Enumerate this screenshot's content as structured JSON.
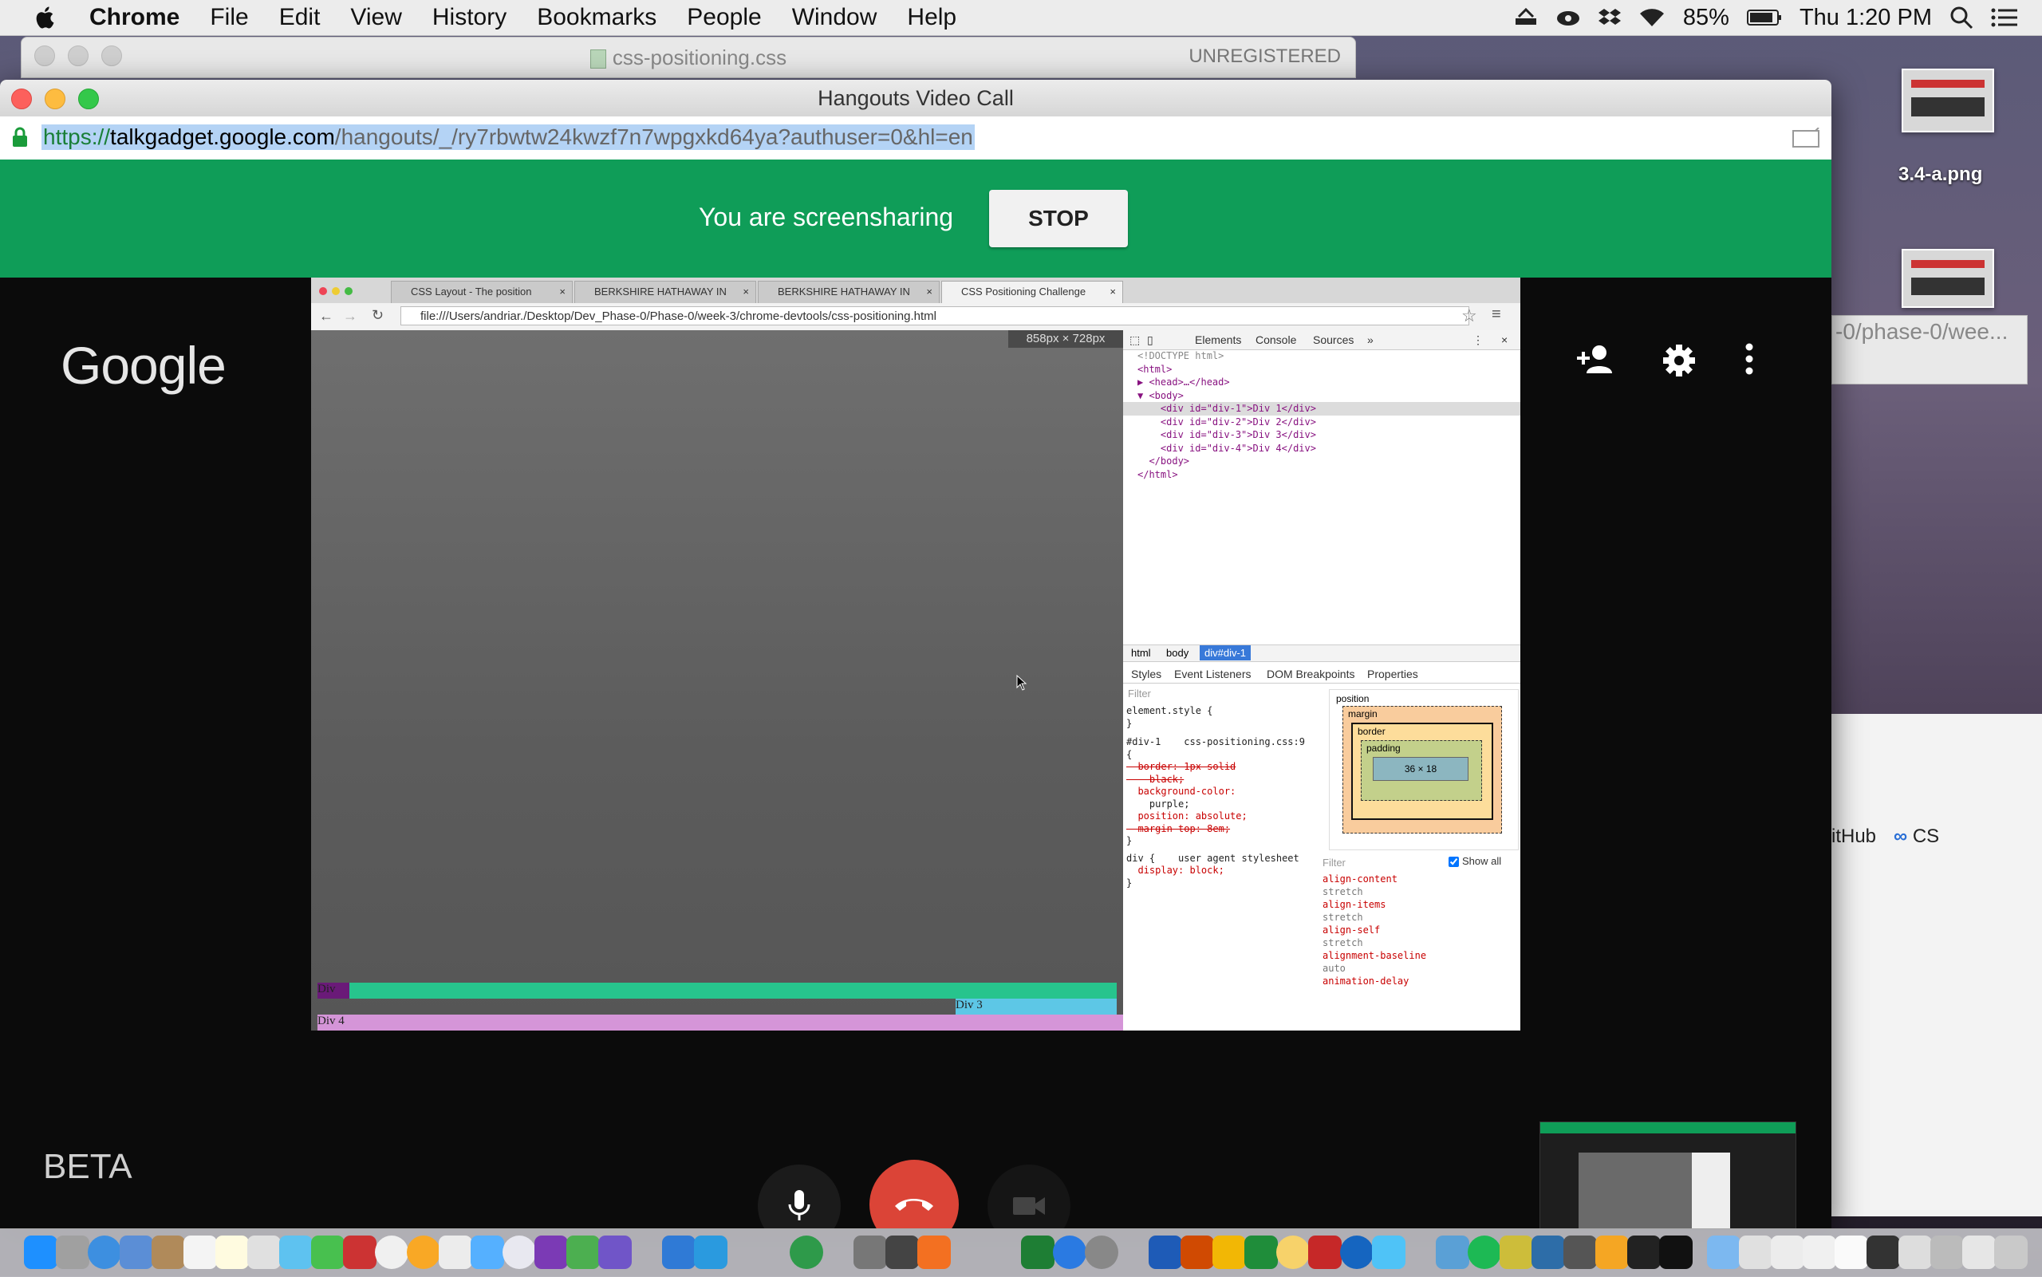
{
  "menubar": {
    "app": "Chrome",
    "items": [
      "File",
      "Edit",
      "View",
      "History",
      "Bookmarks",
      "People",
      "Window",
      "Help"
    ],
    "battery": "85%",
    "clock": "Thu 1:20 PM"
  },
  "sublime": {
    "title": "css-positioning.css",
    "status": "UNREGISTERED"
  },
  "desktop": {
    "file_label": "3.4-a.png",
    "window_url_fragment": "-0/phase-0/wee...",
    "bookmarks": [
      "itHub",
      "CS"
    ]
  },
  "hangouts": {
    "window_title": "Hangouts Video Call",
    "url": {
      "scheme": "https://",
      "host": "talkgadget.google.com",
      "path": "/hangouts/_/ry7rbwtw24kwzf7n7wpgxkd64ya?authuser=0&hl=en"
    },
    "screensharing_text": "You are screensharing",
    "stop_label": "STOP",
    "logo": "Google",
    "beta_label": "BETA",
    "icons": [
      "add-person-icon",
      "settings-icon",
      "more-vert-icon"
    ],
    "colors": {
      "share_bar": "#0f9d58",
      "hangup": "#db4437"
    }
  },
  "shared_screen": {
    "tabs": [
      "CSS Layout - The position",
      "BERKSHIRE HATHAWAY IN",
      "BERKSHIRE HATHAWAY IN",
      "CSS Positioning Challenge"
    ],
    "address": "file:///Users/andriar./Desktop/Dev_Phase-0/Phase-0/week-3/chrome-devtools/css-positioning.html",
    "viewport_size": "858px × 728px",
    "divs": {
      "div1": "Div",
      "div3": "Div 3",
      "div4": "Div 4"
    },
    "devtools": {
      "tabs": [
        "Elements",
        "Console",
        "Sources",
        "»"
      ],
      "dom": [
        "<!DOCTYPE html>",
        "<html>",
        "▶ <head>…</head>",
        "▼ <body>",
        "    <div id=\"div-1\">Div 1</div>",
        "    <div id=\"div-2\">Div 2</div>",
        "    <div id=\"div-3\">Div 3</div>",
        "    <div id=\"div-4\">Div 4</div>",
        "  </body>",
        "</html>"
      ],
      "crumbs": [
        "html",
        "body",
        "div#div-1"
      ],
      "subtabs": [
        "Styles",
        "Event Listeners",
        "DOM Breakpoints",
        "Properties"
      ],
      "filter": "Filter",
      "styles": [
        "element.style {",
        "}",
        "#div-1    css-positioning.css:9",
        "{",
        "  border: 1px solid",
        "    black;",
        "  background-color:",
        "    purple;",
        "  position: absolute;",
        "  margin-top: 8em;",
        "}",
        "div {    user agent stylesheet",
        "  display: block;",
        "}"
      ],
      "box": {
        "position": "position",
        "margin": "margin",
        "border": "border",
        "padding": "padding",
        "content": "36 × 18",
        "dash": "-"
      },
      "show_all": "Show all",
      "computed": [
        "align-content",
        "stretch",
        "align-items",
        "stretch",
        "align-self",
        "stretch",
        "alignment-baseline",
        "auto",
        "animation-delay"
      ]
    }
  }
}
